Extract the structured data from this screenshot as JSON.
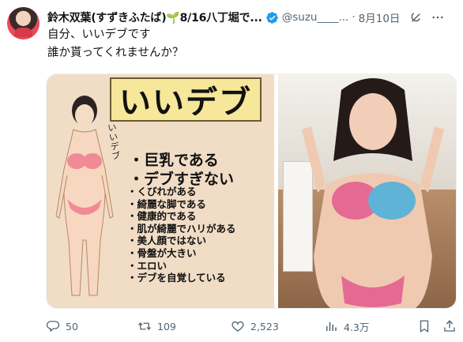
{
  "tweet": {
    "display_name": "鈴木双葉(すずきふたば)🌱8/16八丁堀で...",
    "handle": "@suzu____...",
    "separator": "·",
    "date": "8月10日",
    "text_lines": [
      "自分、いいデブです",
      "誰か貰ってくれませんか？"
    ]
  },
  "media": {
    "left_image": {
      "sign_title": "いいデブ",
      "vertical_label": "いいデブ",
      "headline_lines": [
        "・巨乳である",
        "・デブすぎない"
      ],
      "list_items": [
        "・くびれがある",
        "・綺麗な脚である",
        "・健康的である",
        "・肌が綺麗でハリがある",
        "・美人顔ではない",
        "・骨盤が大きい",
        "・エロい",
        "・デブを自覚している"
      ]
    }
  },
  "actions": {
    "replies": "50",
    "retweets": "109",
    "likes": "2,523",
    "views": "4.3万"
  },
  "icons": {
    "verified": "verified-badge-icon",
    "grok": "grok-icon",
    "more": "more-icon",
    "reply": "reply-icon",
    "retweet": "retweet-icon",
    "like": "heart-icon",
    "views": "views-icon",
    "bookmark": "bookmark-icon",
    "share": "share-icon"
  },
  "colors": {
    "verified_blue": "#1d9bf0",
    "muted_text": "#536471",
    "text": "#0f1419"
  }
}
